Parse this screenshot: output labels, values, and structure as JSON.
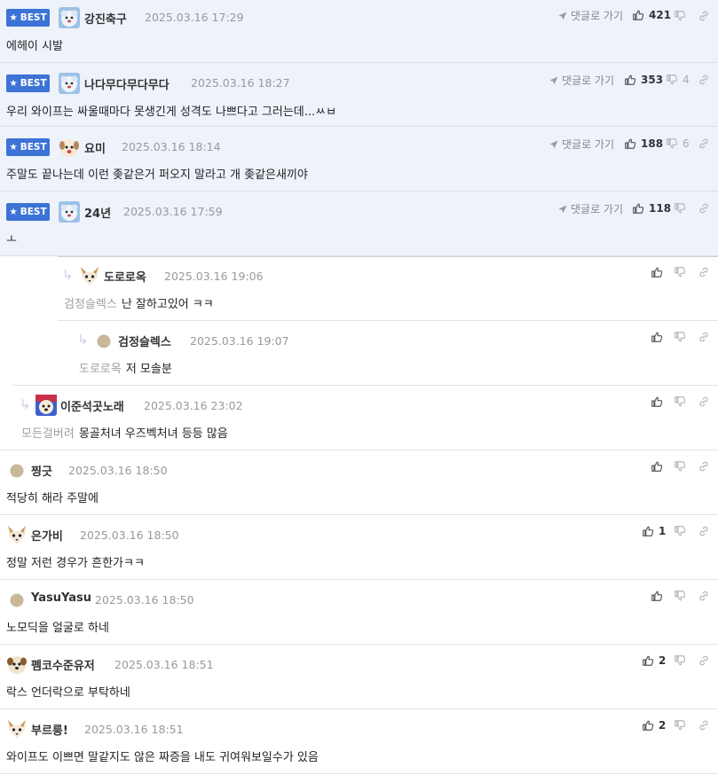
{
  "labels": {
    "best": "BEST",
    "goto_reply": "댓글로 가기"
  },
  "colors": {
    "best_badge": "#3d73d6",
    "best_bg": "#eef2fb"
  },
  "comments": [
    {
      "best": true,
      "nick": "강진축구",
      "date": "2025.03.16 17:29",
      "text": "에헤이 시발",
      "goto": true,
      "likes": "421",
      "dislikes": "",
      "avatar": "blue-fluffy"
    },
    {
      "best": true,
      "nick": "나다무다무다무다",
      "date": "2025.03.16 18:27",
      "text": "우리 와이프는 싸울때마다 못생긴게 성격도 나쁘다고 그러는데...ㅆㅂ",
      "goto": true,
      "likes": "353",
      "dislikes": "4",
      "avatar": "blue-fluffy"
    },
    {
      "best": true,
      "nick": "요미",
      "date": "2025.03.16 18:14",
      "text": "주말도 끝나는데 이런 좆같은거 퍼오지 말라고 개 좆같은새끼야",
      "goto": true,
      "likes": "188",
      "dislikes": "6",
      "avatar": "puppy"
    },
    {
      "best": true,
      "nick": "24년",
      "date": "2025.03.16 17:59",
      "text": "ㅗ",
      "goto": true,
      "likes": "118",
      "dislikes": "",
      "avatar": "blue-fluffy"
    },
    {
      "best": false,
      "nick": "도로로옥",
      "date": "2025.03.16 19:06",
      "mention": "검정슬렉스",
      "text": "난 잘하고있어 ㅋㅋ",
      "likes": "",
      "dislikes": "",
      "avatar": "fox"
    },
    {
      "best": false,
      "nick": "검정슬렉스",
      "date": "2025.03.16 19:07",
      "mention": "도로로옥",
      "text": "저 모솔분",
      "likes": "",
      "dislikes": "",
      "avatar": "circle"
    },
    {
      "best": false,
      "nick": "이준석곳노래",
      "date": "2025.03.16 23:02",
      "mention": "모든걸버려",
      "text": "몽골처녀 우즈벡처녀 등등 많음",
      "likes": "",
      "dislikes": "",
      "avatar": "colorful-dog"
    },
    {
      "best": false,
      "nick": "찡긋",
      "date": "2025.03.16 18:50",
      "text": "적당히 해라 주말에",
      "likes": "",
      "dislikes": "",
      "avatar": "circle"
    },
    {
      "best": false,
      "nick": "은가비",
      "date": "2025.03.16 18:50",
      "text": "정말 저런 경우가 흔한가ㅋㅋ",
      "likes": "1",
      "dislikes": "",
      "avatar": "fox"
    },
    {
      "best": false,
      "nick": "YasuYasu",
      "date": "2025.03.16 18:50",
      "text": "노모딕을 얼굴로 하네",
      "likes": "",
      "dislikes": "",
      "avatar": "circle"
    },
    {
      "best": false,
      "nick": "펨코수준유저",
      "date": "2025.03.16 18:51",
      "text": "락스 언더락으로 부탁하네",
      "likes": "2",
      "dislikes": "",
      "avatar": "brown-dog"
    },
    {
      "best": false,
      "nick": "부르릉!",
      "date": "2025.03.16 18:51",
      "text": "와이프도 이쁘면 말같지도 않은 짜증을 내도 귀여워보일수가 있음",
      "likes": "2",
      "dislikes": "",
      "avatar": "fox"
    }
  ]
}
